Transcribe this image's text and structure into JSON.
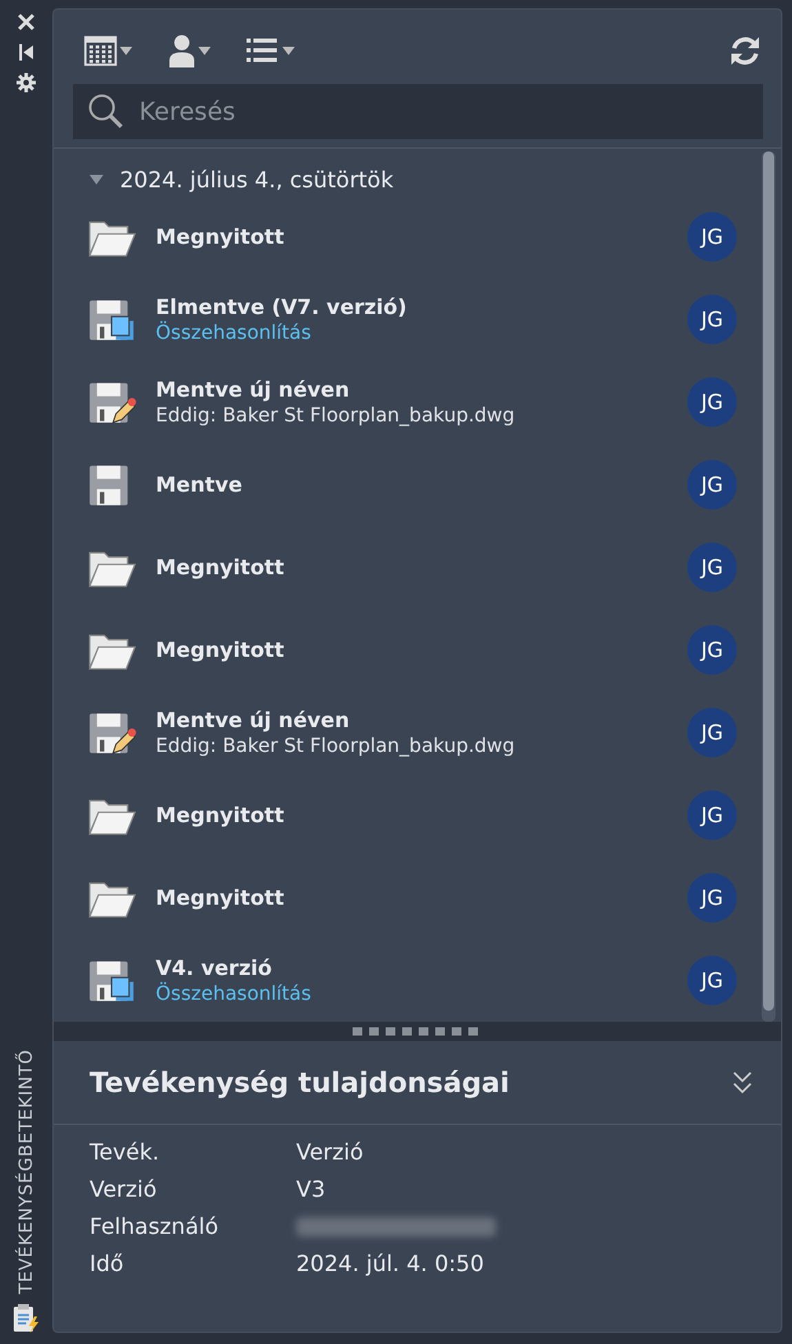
{
  "side_strip": {
    "title": "TEVÉKENYSÉGBETEKINTŐ"
  },
  "search": {
    "placeholder": "Keresés"
  },
  "group": {
    "label": "2024. július 4., csütörtök",
    "expanded": true
  },
  "activities": [
    {
      "kind": "opened",
      "title": "Megnyitott",
      "user": "JG"
    },
    {
      "kind": "version",
      "title": "Elmentve (V7. verzió)",
      "subtitle": "Összehasonlítás",
      "subtitle_is_link": true,
      "user": "JG"
    },
    {
      "kind": "saved_as",
      "title": "Mentve új néven",
      "subtitle": "Eddig: Baker St Floorplan_bakup.dwg",
      "subtitle_is_link": false,
      "user": "JG"
    },
    {
      "kind": "saved",
      "title": "Mentve",
      "user": "JG"
    },
    {
      "kind": "opened",
      "title": "Megnyitott",
      "user": "JG"
    },
    {
      "kind": "opened",
      "title": "Megnyitott",
      "user": "JG"
    },
    {
      "kind": "saved_as",
      "title": "Mentve új néven",
      "subtitle": "Eddig: Baker St Floorplan_bakup.dwg",
      "subtitle_is_link": false,
      "user": "JG"
    },
    {
      "kind": "opened",
      "title": "Megnyitott",
      "user": "JG"
    },
    {
      "kind": "opened",
      "title": "Megnyitott",
      "user": "JG"
    },
    {
      "kind": "version",
      "title": "V4. verzió",
      "subtitle": "Összehasonlítás",
      "subtitle_is_link": true,
      "user": "JG"
    }
  ],
  "properties": {
    "title": "Tevékenység tulajdonságai",
    "expanded": true,
    "rows": [
      {
        "label": "Tevék.",
        "value": "Verzió"
      },
      {
        "label": "Verzió",
        "value": "V3"
      },
      {
        "label": "Felhasználó",
        "value_blurred": true
      },
      {
        "label": "Idő",
        "value": "2024. júl. 4. 0:50"
      }
    ]
  }
}
